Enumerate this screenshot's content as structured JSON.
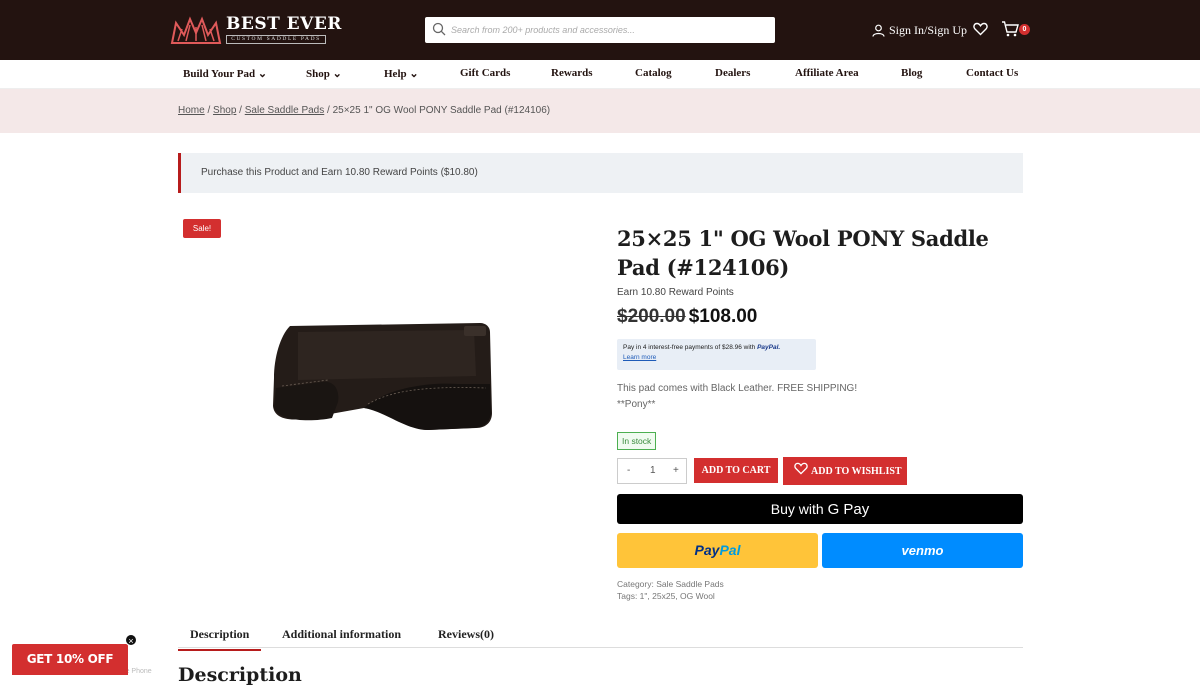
{
  "header": {
    "logo": {
      "name": "BEST EVER",
      "tagline": "CUSTOM SADDLE PADS"
    },
    "search": {
      "placeholder": "Search from 200+ products and accessories..."
    },
    "signin_label": "Sign In/Sign Up",
    "cart_count": "0"
  },
  "nav": {
    "items": [
      {
        "label": "Build Your Pad",
        "dropdown": true
      },
      {
        "label": "Shop",
        "dropdown": true
      },
      {
        "label": "Help",
        "dropdown": true
      },
      {
        "label": "Gift Cards"
      },
      {
        "label": "Rewards"
      },
      {
        "label": "Catalog"
      },
      {
        "label": "Dealers"
      },
      {
        "label": "Affiliate Area"
      },
      {
        "label": "Blog"
      },
      {
        "label": "Contact Us"
      }
    ]
  },
  "breadcrumb": {
    "items": [
      "Home",
      "Shop",
      "Sale Saddle Pads"
    ],
    "current": "25×25 1\" OG Wool PONY Saddle Pad (#124106)"
  },
  "notice": "Purchase this Product and Earn 10.80 Reward Points ($10.80)",
  "product": {
    "badge": "Sale!",
    "title": "25×25 1\" OG Wool PONY Saddle Pad (#124106)",
    "reward": "Earn 10.80 Reward Points",
    "old_price": "$200.00",
    "price": "$108.00",
    "paypal_message": "Pay in 4 interest-free payments of $28.96 with",
    "paypal_brand": "PayPal.",
    "paypal_learn": "Learn more",
    "description_line1": "This pad comes with Black Leather. FREE SHIPPING!",
    "description_line2": "**Pony**",
    "stock": "In stock",
    "quantity": "1",
    "qty_minus": "-",
    "qty_plus": "+",
    "add_to_cart": "ADD TO CART",
    "add_to_wishlist": "ADD TO WISHLIST",
    "gpay_label": "Buy with",
    "gpay_brand": "G Pay",
    "paypal_btn_1": "Pay",
    "paypal_btn_2": "Pal",
    "venmo_label": "venmo",
    "category": "Category: Sale Saddle Pads",
    "tags": "Tags: 1\", 25x25, OG Wool"
  },
  "tabs": [
    "Description",
    "Additional information",
    "Reviews(0)"
  ],
  "description_heading": "Description",
  "ghost_text": "Leather Saddle Phone",
  "promo": {
    "label": "GET 10% OFF",
    "close": "×"
  },
  "colors": {
    "header_bg": "#231310",
    "accent": "#d32f2f",
    "crumb_bg": "#f4e8e8"
  }
}
